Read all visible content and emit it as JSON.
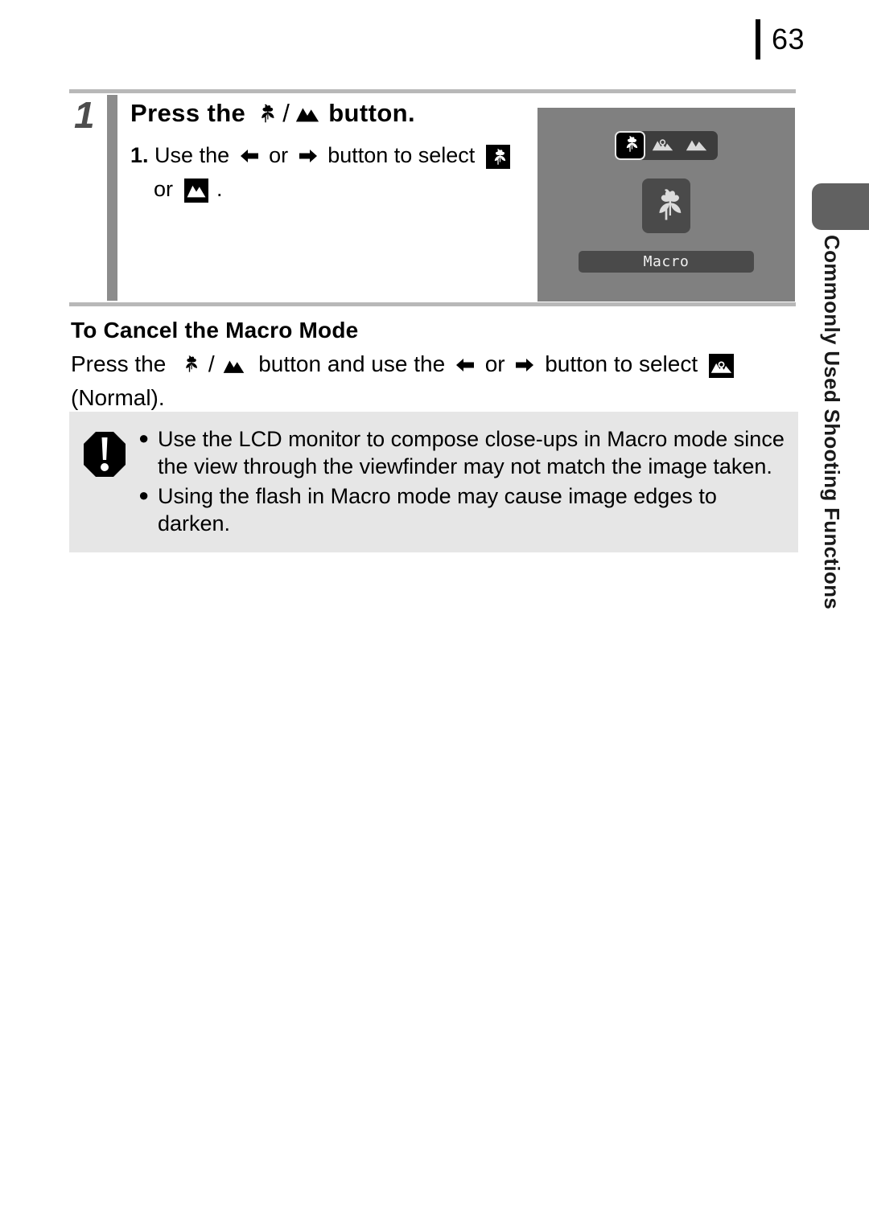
{
  "page": {
    "number": "63",
    "side_tab_label": "Commonly Used Shooting Functions"
  },
  "step": {
    "number": "1",
    "title_prefix": "Press the",
    "title_suffix": "button.",
    "title_icon_macro": "macro-tulip-icon",
    "title_icon_landscape": "landscape-mountains-icon",
    "substep_number": "1.",
    "substep_text_1": "Use the",
    "substep_text_2": "or",
    "substep_text_3": "button to select",
    "substep_text_4": "or",
    "substep_text_5": ".",
    "arrow_left": "arrow-left-icon",
    "arrow_right": "arrow-right-icon"
  },
  "lcd": {
    "modes": [
      {
        "name": "macro-tulip-icon",
        "selected": true
      },
      {
        "name": "normal-mountains-sun-icon",
        "selected": false
      },
      {
        "name": "infinity-mountains-icon",
        "selected": false
      }
    ],
    "selected_icon": "macro-tulip-icon",
    "label": "Macro"
  },
  "cancel": {
    "heading": "To Cancel the Macro Mode",
    "text_1": "Press the",
    "text_2": "button and use the",
    "text_3": "or",
    "text_4": "button to select",
    "text_5": "(Normal)."
  },
  "note": {
    "badge_icon": "caution-exclamation-icon",
    "bullet": "●",
    "items": [
      "Use the LCD monitor to compose close-ups in Macro mode since the view through the viewfinder may not match the image taken.",
      "Using the flash in Macro mode may cause image edges to darken."
    ]
  },
  "colors": {
    "lcd_background": "#808080",
    "lcd_panel": "#4a4a4a",
    "note_background": "#e6e6e6",
    "side_tab": "#616161",
    "rule": "#b8b8b8",
    "step_bar": "#8c8c8c"
  }
}
